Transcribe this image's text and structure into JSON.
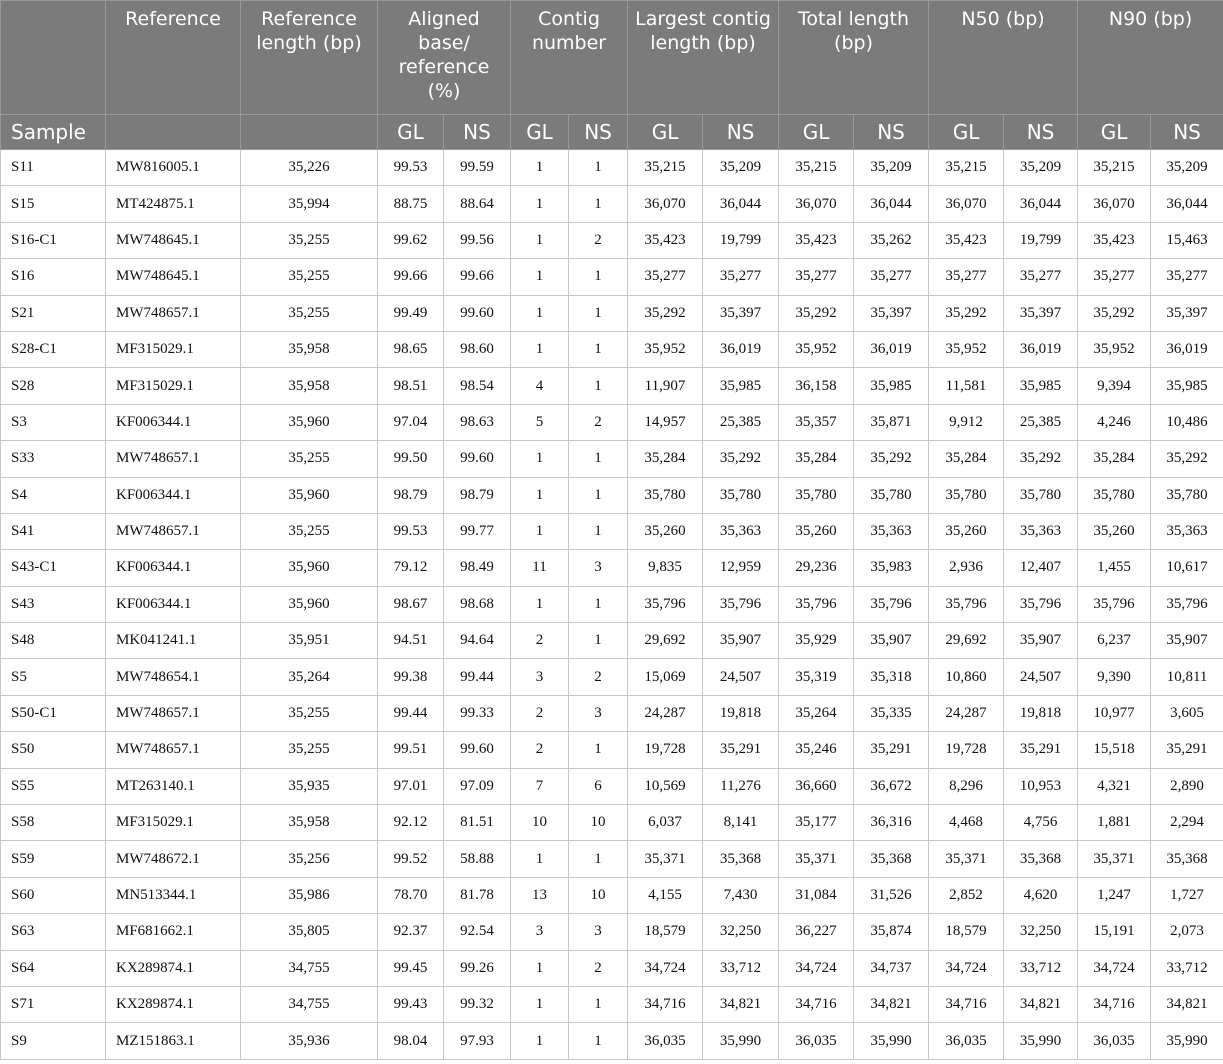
{
  "header": {
    "top": [
      "",
      "Reference",
      "Reference length (bp)",
      "Aligned base/ reference (%)",
      "Contig number",
      "Largest contig length (bp)",
      "Total length (bp)",
      "N50 (bp)",
      "N90 (bp)"
    ],
    "sample_label": "Sample",
    "gl": "GL",
    "ns": "NS"
  },
  "rows": [
    [
      "S11",
      "MW816005.1",
      "35,226",
      "99.53",
      "99.59",
      "1",
      "1",
      "35,215",
      "35,209",
      "35,215",
      "35,209",
      "35,215",
      "35,209",
      "35,215",
      "35,209"
    ],
    [
      "S15",
      "MT424875.1",
      "35,994",
      "88.75",
      "88.64",
      "1",
      "1",
      "36,070",
      "36,044",
      "36,070",
      "36,044",
      "36,070",
      "36,044",
      "36,070",
      "36,044"
    ],
    [
      "S16-C1",
      "MW748645.1",
      "35,255",
      "99.62",
      "99.56",
      "1",
      "2",
      "35,423",
      "19,799",
      "35,423",
      "35,262",
      "35,423",
      "19,799",
      "35,423",
      "15,463"
    ],
    [
      "S16",
      "MW748645.1",
      "35,255",
      "99.66",
      "99.66",
      "1",
      "1",
      "35,277",
      "35,277",
      "35,277",
      "35,277",
      "35,277",
      "35,277",
      "35,277",
      "35,277"
    ],
    [
      "S21",
      "MW748657.1",
      "35,255",
      "99.49",
      "99.60",
      "1",
      "1",
      "35,292",
      "35,397",
      "35,292",
      "35,397",
      "35,292",
      "35,397",
      "35,292",
      "35,397"
    ],
    [
      "S28-C1",
      "MF315029.1",
      "35,958",
      "98.65",
      "98.60",
      "1",
      "1",
      "35,952",
      "36,019",
      "35,952",
      "36,019",
      "35,952",
      "36,019",
      "35,952",
      "36,019"
    ],
    [
      "S28",
      "MF315029.1",
      "35,958",
      "98.51",
      "98.54",
      "4",
      "1",
      "11,907",
      "35,985",
      "36,158",
      "35,985",
      "11,581",
      "35,985",
      "9,394",
      "35,985"
    ],
    [
      "S3",
      "KF006344.1",
      "35,960",
      "97.04",
      "98.63",
      "5",
      "2",
      "14,957",
      "25,385",
      "35,357",
      "35,871",
      "9,912",
      "25,385",
      "4,246",
      "10,486"
    ],
    [
      "S33",
      "MW748657.1",
      "35,255",
      "99.50",
      "99.60",
      "1",
      "1",
      "35,284",
      "35,292",
      "35,284",
      "35,292",
      "35,284",
      "35,292",
      "35,284",
      "35,292"
    ],
    [
      "S4",
      "KF006344.1",
      "35,960",
      "98.79",
      "98.79",
      "1",
      "1",
      "35,780",
      "35,780",
      "35,780",
      "35,780",
      "35,780",
      "35,780",
      "35,780",
      "35,780"
    ],
    [
      "S41",
      "MW748657.1",
      "35,255",
      "99.53",
      "99.77",
      "1",
      "1",
      "35,260",
      "35,363",
      "35,260",
      "35,363",
      "35,260",
      "35,363",
      "35,260",
      "35,363"
    ],
    [
      "S43-C1",
      "KF006344.1",
      "35,960",
      "79.12",
      "98.49",
      "11",
      "3",
      "9,835",
      "12,959",
      "29,236",
      "35,983",
      "2,936",
      "12,407",
      "1,455",
      "10,617"
    ],
    [
      "S43",
      "KF006344.1",
      "35,960",
      "98.67",
      "98.68",
      "1",
      "1",
      "35,796",
      "35,796",
      "35,796",
      "35,796",
      "35,796",
      "35,796",
      "35,796",
      "35,796"
    ],
    [
      "S48",
      "MK041241.1",
      "35,951",
      "94.51",
      "94.64",
      "2",
      "1",
      "29,692",
      "35,907",
      "35,929",
      "35,907",
      "29,692",
      "35,907",
      "6,237",
      "35,907"
    ],
    [
      "S5",
      "MW748654.1",
      "35,264",
      "99.38",
      "99.44",
      "3",
      "2",
      "15,069",
      "24,507",
      "35,319",
      "35,318",
      "10,860",
      "24,507",
      "9,390",
      "10,811"
    ],
    [
      "S50-C1",
      "MW748657.1",
      "35,255",
      "99.44",
      "99.33",
      "2",
      "3",
      "24,287",
      "19,818",
      "35,264",
      "35,335",
      "24,287",
      "19,818",
      "10,977",
      "3,605"
    ],
    [
      "S50",
      "MW748657.1",
      "35,255",
      "99.51",
      "99.60",
      "2",
      "1",
      "19,728",
      "35,291",
      "35,246",
      "35,291",
      "19,728",
      "35,291",
      "15,518",
      "35,291"
    ],
    [
      "S55",
      "MT263140.1",
      "35,935",
      "97.01",
      "97.09",
      "7",
      "6",
      "10,569",
      "11,276",
      "36,660",
      "36,672",
      "8,296",
      "10,953",
      "4,321",
      "2,890"
    ],
    [
      "S58",
      "MF315029.1",
      "35,958",
      "92.12",
      "81.51",
      "10",
      "10",
      "6,037",
      "8,141",
      "35,177",
      "36,316",
      "4,468",
      "4,756",
      "1,881",
      "2,294"
    ],
    [
      "S59",
      "MW748672.1",
      "35,256",
      "99.52",
      "58.88",
      "1",
      "1",
      "35,371",
      "35,368",
      "35,371",
      "35,368",
      "35,371",
      "35,368",
      "35,371",
      "35,368"
    ],
    [
      "S60",
      "MN513344.1",
      "35,986",
      "78.70",
      "81.78",
      "13",
      "10",
      "4,155",
      "7,430",
      "31,084",
      "31,526",
      "2,852",
      "4,620",
      "1,247",
      "1,727"
    ],
    [
      "S63",
      "MF681662.1",
      "35,805",
      "92.37",
      "92.54",
      "3",
      "3",
      "18,579",
      "32,250",
      "36,227",
      "35,874",
      "18,579",
      "32,250",
      "15,191",
      "2,073"
    ],
    [
      "S64",
      "KX289874.1",
      "34,755",
      "99.45",
      "99.26",
      "1",
      "2",
      "34,724",
      "33,712",
      "34,724",
      "34,737",
      "34,724",
      "33,712",
      "34,724",
      "33,712"
    ],
    [
      "S71",
      "KX289874.1",
      "34,755",
      "99.43",
      "99.32",
      "1",
      "1",
      "34,716",
      "34,821",
      "34,716",
      "34,821",
      "34,716",
      "34,821",
      "34,716",
      "34,821"
    ],
    [
      "S9",
      "MZ151863.1",
      "35,936",
      "98.04",
      "97.93",
      "1",
      "1",
      "36,035",
      "35,990",
      "36,035",
      "35,990",
      "36,035",
      "35,990",
      "36,035",
      "35,990"
    ]
  ],
  "colors": {
    "header_bg": "#7b7b7b",
    "header_text": "#ffffff",
    "grid": "#c8c8c8"
  }
}
